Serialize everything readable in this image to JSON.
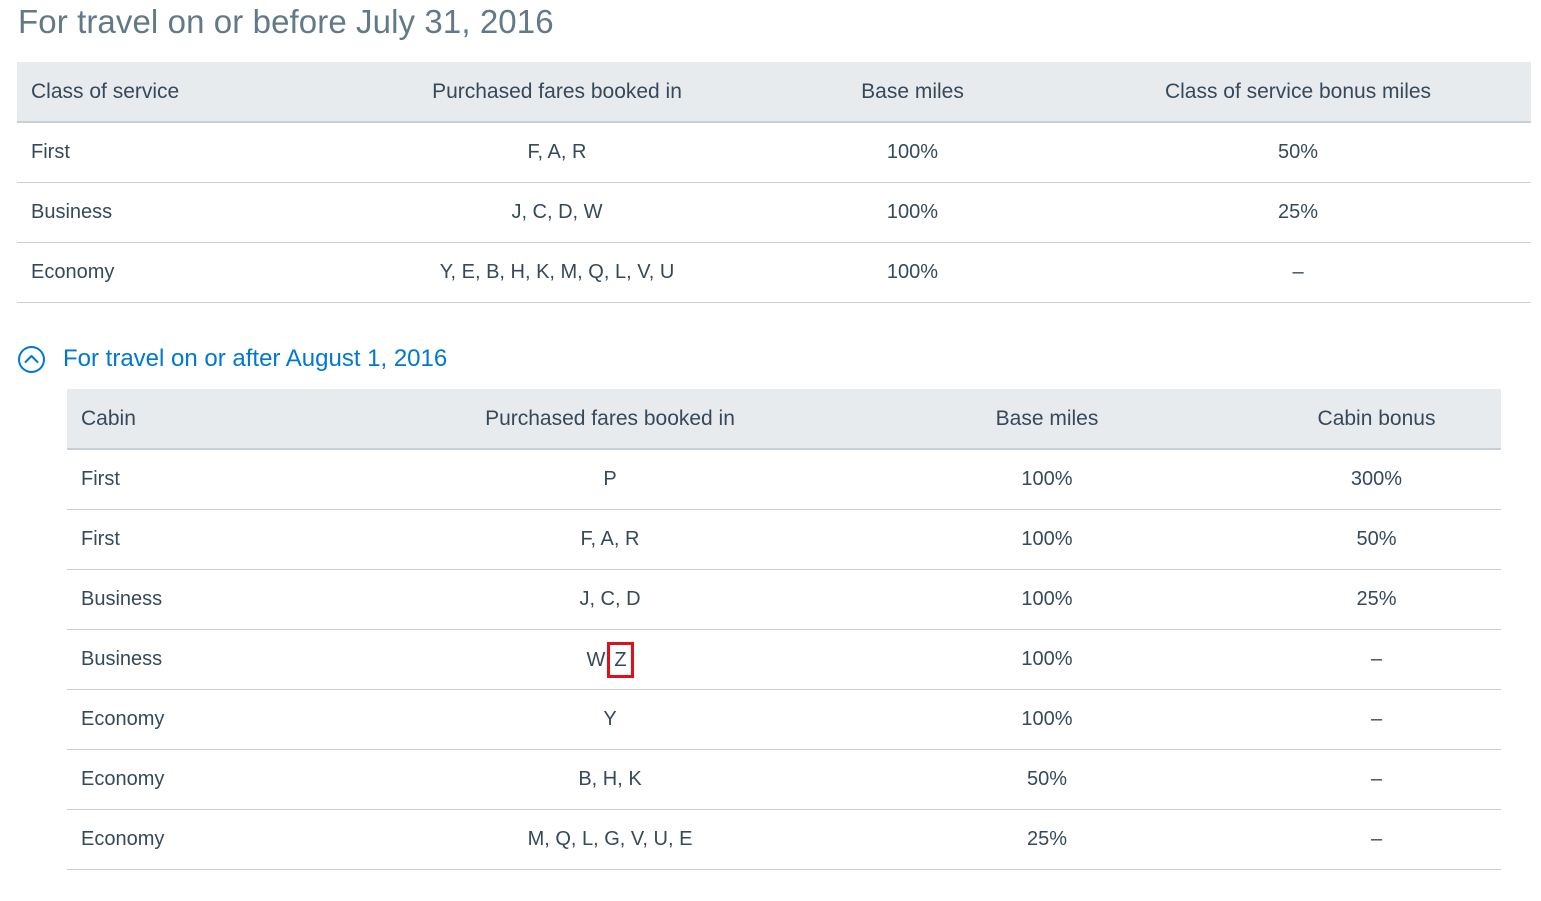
{
  "section1": {
    "heading": "For travel on or before July 31, 2016",
    "columns": [
      "Class of service",
      "Purchased fares booked in",
      "Base miles",
      "Class of service bonus miles"
    ],
    "rows": [
      [
        "First",
        "F, A, R",
        "100%",
        "50%"
      ],
      [
        "Business",
        "J, C, D, W",
        "100%",
        "25%"
      ],
      [
        "Economy",
        "Y, E, B, H, K, M, Q, L, V, U",
        "100%",
        "–"
      ]
    ]
  },
  "section2": {
    "toggle_label": "For travel on or after August 1, 2016",
    "toggle_icon": "chevron-up-circle-icon",
    "accent_color": "#0078d2",
    "highlight_color": "#e0101a",
    "columns": [
      "Cabin",
      "Purchased fares booked in",
      "Base miles",
      "Cabin bonus"
    ],
    "rows": [
      [
        "First",
        "P",
        "100%",
        "300%"
      ],
      [
        "First",
        "F, A, R",
        "100%",
        "50%"
      ],
      [
        "Business",
        "J, C, D",
        "100%",
        "25%"
      ],
      [
        "Business",
        "W",
        "100%",
        "–"
      ],
      [
        "Economy",
        "Y",
        "100%",
        "–"
      ],
      [
        "Economy",
        "B, H, K",
        "50%",
        "–"
      ],
      [
        "Economy",
        "M, Q, L, G, V, U, E",
        "25%",
        "–"
      ]
    ],
    "highlighted_fare": "Z"
  }
}
